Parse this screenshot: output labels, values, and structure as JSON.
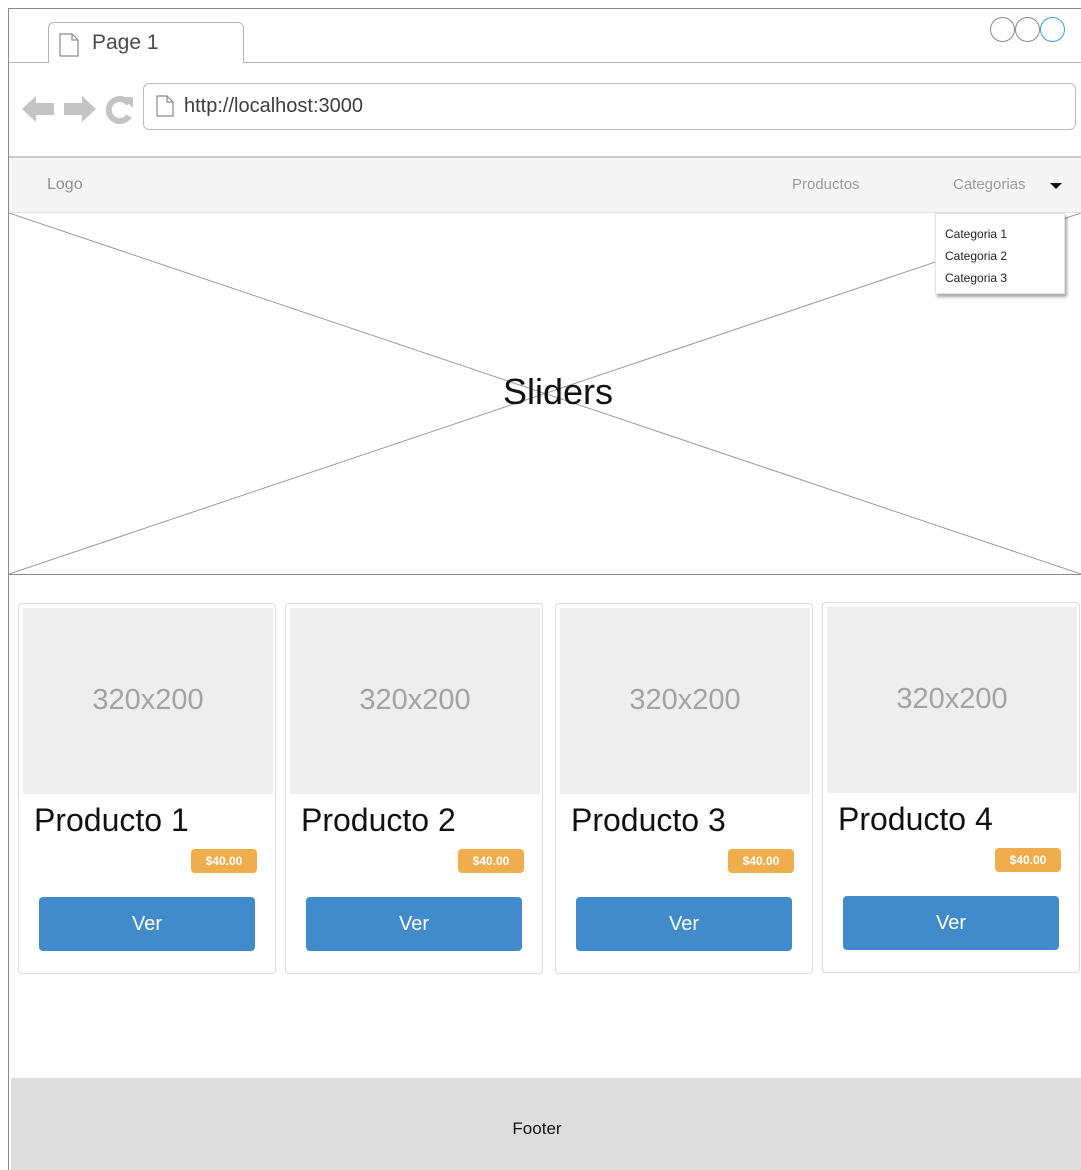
{
  "browser": {
    "tab_title": "Page 1",
    "url": "http://localhost:3000"
  },
  "navbar": {
    "logo": "Logo",
    "productos": "Productos",
    "categorias": "Categorias",
    "dropdown": [
      "Categoria 1",
      "Categoria 2",
      "Categoria 3"
    ]
  },
  "slider": {
    "label": "Sliders"
  },
  "products": [
    {
      "image_label": "320x200",
      "title": "Producto 1",
      "price": "$40.00",
      "button": "Ver"
    },
    {
      "image_label": "320x200",
      "title": "Producto 2",
      "price": "$40.00",
      "button": "Ver"
    },
    {
      "image_label": "320x200",
      "title": "Producto 3",
      "price": "$40.00",
      "button": "Ver"
    },
    {
      "image_label": "320x200",
      "title": "Producto 4",
      "price": "$40.00",
      "button": "Ver"
    }
  ],
  "footer": {
    "text": "Footer"
  },
  "colors": {
    "price_badge": "#f0ad4e",
    "button": "#428bca",
    "footer_bg": "#dddddd",
    "accent_circle": "#3b9be4"
  },
  "icons": [
    "page-icon",
    "back-arrow-icon",
    "forward-arrow-icon",
    "reload-icon",
    "caret-down-icon"
  ]
}
